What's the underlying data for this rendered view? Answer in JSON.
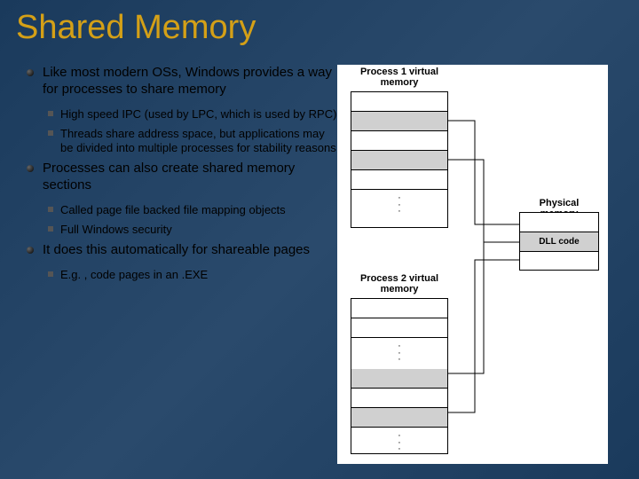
{
  "title": "Shared Memory",
  "bullets": {
    "b1": "Like most modern OSs, Windows provides a way for processes to share memory",
    "b1a": "High speed IPC (used by LPC, which is used by RPC)",
    "b1b": "Threads share address space, but applications may be divided into multiple processes for stability reasons",
    "b2": "Processes can also create shared memory sections",
    "b2a": "Called page file backed file mapping objects",
    "b2b": "Full Windows security",
    "b3": "It does this automatically for shareable pages",
    "b3a": "E.g. , code pages in an .EXE"
  },
  "diagram": {
    "proc1_label": "Process 1 virtual memory",
    "proc2_label": "Process 2 virtual memory",
    "phys_label": "Physical memory",
    "dll_label": "DLL code"
  }
}
